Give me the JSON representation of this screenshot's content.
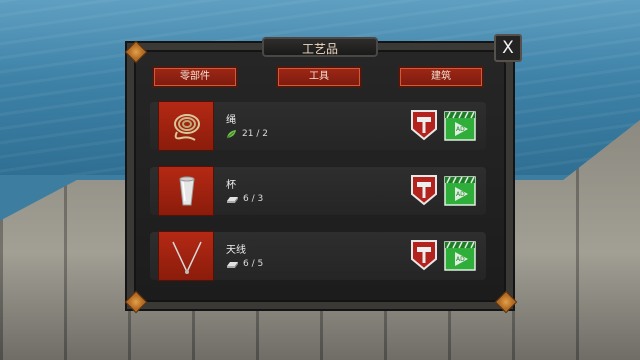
{
  "window": {
    "title": "工艺品",
    "close_label": "X"
  },
  "tabs": [
    {
      "label": "零部件"
    },
    {
      "label": "工具"
    },
    {
      "label": "建筑"
    }
  ],
  "recipes": [
    {
      "name": "绳",
      "requirement": "21 / 2",
      "requirement_icon": "leaf-icon",
      "item_icon": "rope-coil-icon"
    },
    {
      "name": "杯",
      "requirement": "6 / 3",
      "requirement_icon": "metal-ingot-icon",
      "item_icon": "cup-icon"
    },
    {
      "name": "天线",
      "requirement": "6 / 5",
      "requirement_icon": "metal-ingot-icon",
      "item_icon": "antenna-icon"
    }
  ],
  "buttons": {
    "ad_label": "AD"
  },
  "colors": {
    "tab_red": "#9e2716",
    "craft_red": "#b3221c",
    "ad_green": "#2fae3a",
    "corner_orange": "#d9903c"
  }
}
